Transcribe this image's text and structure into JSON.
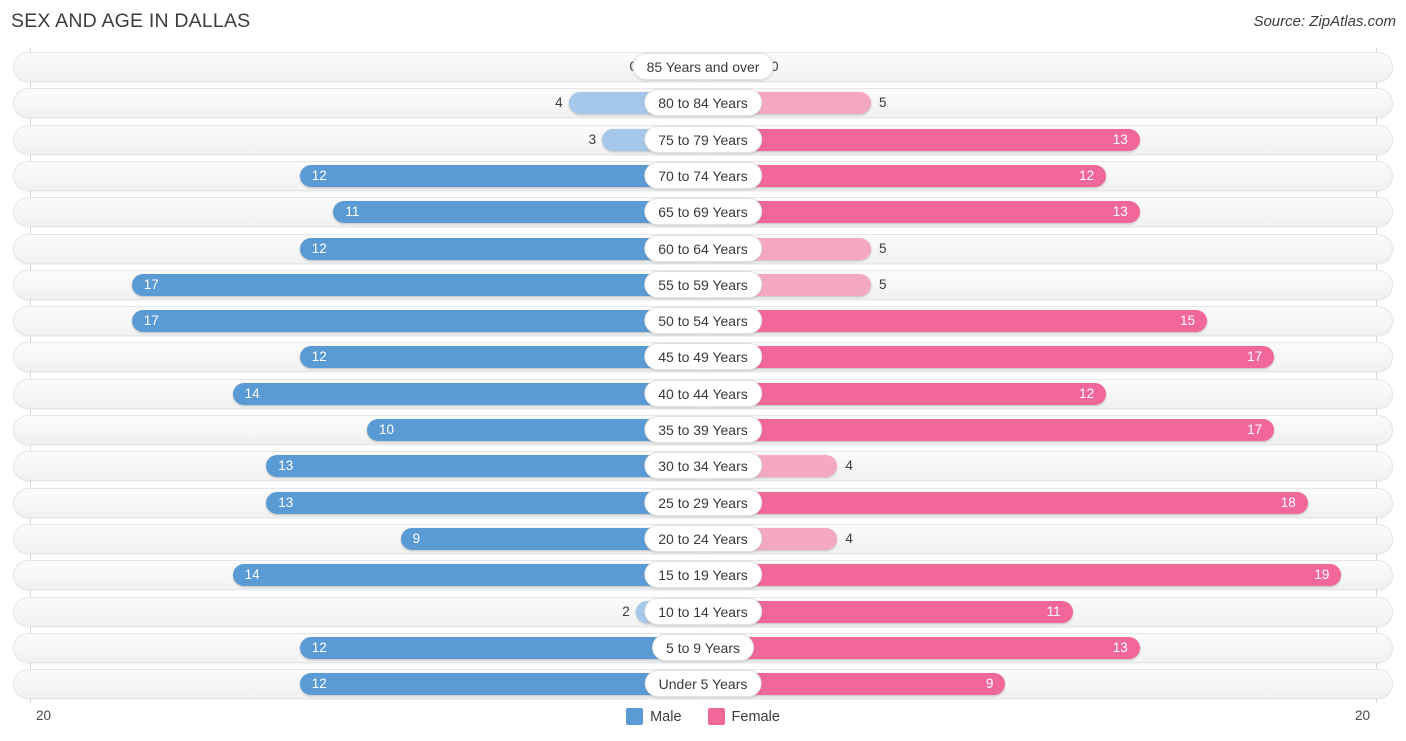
{
  "header": {
    "title": "SEX AND AGE IN DALLAS",
    "source": "Source: ZipAtlas.com"
  },
  "legend": {
    "male": {
      "label": "Male",
      "color": "#5b9bd5"
    },
    "female": {
      "label": "Female",
      "color": "#f2679a"
    }
  },
  "axis": {
    "left_end": "20",
    "right_end": "20"
  },
  "chart_data": {
    "type": "bar",
    "subtype": "population-pyramid",
    "title": "SEX AND AGE IN DALLAS",
    "xlabel": "",
    "ylabel": "",
    "xlim": [
      20,
      20
    ],
    "grid": false,
    "legend_position": "bottom-center",
    "categories": [
      "85 Years and over",
      "80 to 84 Years",
      "75 to 79 Years",
      "70 to 74 Years",
      "65 to 69 Years",
      "60 to 64 Years",
      "55 to 59 Years",
      "50 to 54 Years",
      "45 to 49 Years",
      "40 to 44 Years",
      "35 to 39 Years",
      "30 to 34 Years",
      "25 to 29 Years",
      "20 to 24 Years",
      "15 to 19 Years",
      "10 to 14 Years",
      "5 to 9 Years",
      "Under 5 Years"
    ],
    "series": [
      {
        "name": "Male",
        "color": "#5b9bd5",
        "values": [
          0,
          4,
          3,
          12,
          11,
          12,
          17,
          17,
          12,
          14,
          10,
          13,
          13,
          9,
          14,
          2,
          12,
          12
        ]
      },
      {
        "name": "Female",
        "color": "#f2679a",
        "values": [
          0,
          5,
          13,
          12,
          13,
          5,
          5,
          15,
          17,
          12,
          17,
          4,
          18,
          4,
          19,
          11,
          13,
          9
        ]
      }
    ]
  }
}
